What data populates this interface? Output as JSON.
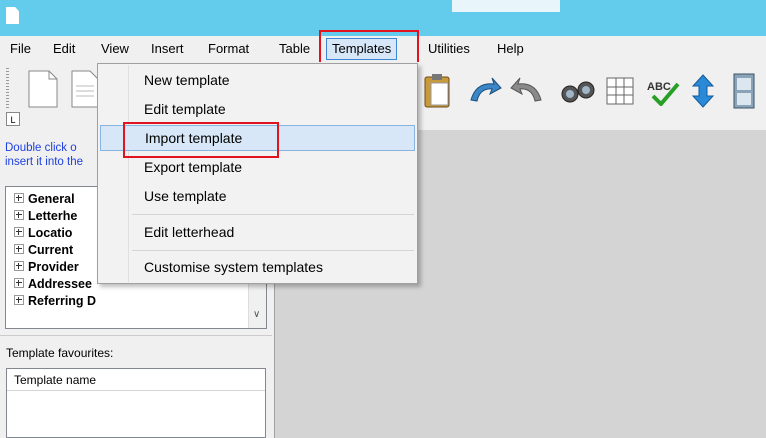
{
  "menubar": {
    "items": [
      "File",
      "Edit",
      "View",
      "Insert",
      "Format",
      "Table",
      "Templates",
      "Utilities",
      "Help"
    ],
    "active": "Templates"
  },
  "dropdown": {
    "items": [
      "New template",
      "Edit template",
      "Import template",
      "Export template",
      "Use template",
      "Edit letterhead",
      "Customise system templates"
    ],
    "highlighted": "Import template"
  },
  "left_pane": {
    "hint_line1": "Double click o",
    "hint_line2": "insert it into the",
    "tree_items": [
      "General",
      "Letterhe",
      "Locatio",
      "Current",
      "Provider",
      "Addressee",
      "Referring D"
    ],
    "favourites_label": "Template favourites:",
    "favourites_column": "Template name"
  },
  "toolbar_icons": [
    "new-document-icon",
    "open-document-icon",
    "paste-icon",
    "undo-icon",
    "redo-icon",
    "find-icon",
    "table-icon",
    "spellcheck-icon",
    "sort-icon",
    "cabinet-icon"
  ],
  "small_button_label": "L",
  "colors": {
    "titlebar": "#63cbeb",
    "highlight": "#d7e7f7",
    "callout": "#e0141e",
    "hint_text": "#1f40e0"
  }
}
